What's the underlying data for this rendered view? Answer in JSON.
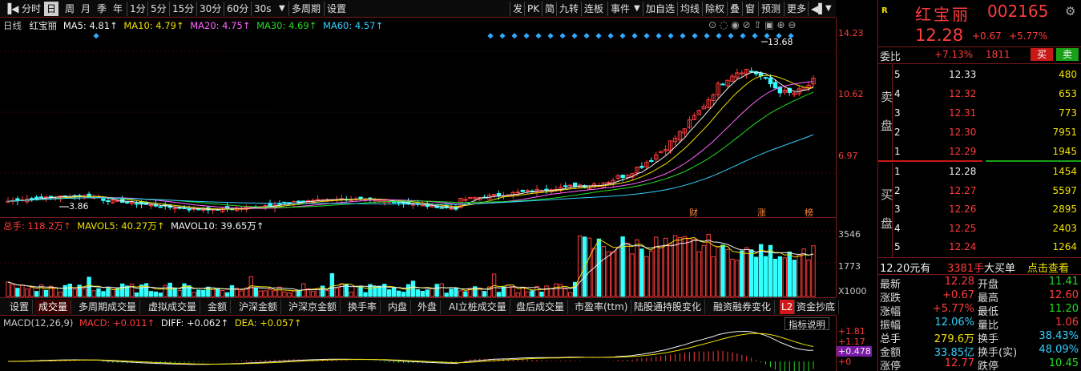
{
  "toolbar": {
    "left_items": [
      "分时",
      "日",
      "周",
      "月",
      "季",
      "年",
      "1分",
      "5分",
      "15分",
      "30分",
      "60分",
      "30s",
      "多周期",
      "设置"
    ],
    "active": "日",
    "right_items": [
      "发",
      "PK",
      "简",
      "九转",
      "连板",
      "事件",
      "加自选",
      "均线",
      "除权",
      "叠",
      "窗",
      "预测",
      "更多"
    ]
  },
  "main": {
    "legend_name": "日线",
    "stock_name": "红宝丽",
    "ma": [
      {
        "label": "MA5: 4.81↑",
        "color": "#f0f0f0"
      },
      {
        "label": "MA10: 4.79↑",
        "color": "#f0e000"
      },
      {
        "label": "MA20: 4.75↑",
        "color": "#ff66ff"
      },
      {
        "label": "MA30: 4.69↑",
        "color": "#22dd22"
      },
      {
        "label": "MA60: 4.57↑",
        "color": "#33d0ff"
      }
    ],
    "y_ticks": [
      "14.23",
      "10.62",
      "6.97"
    ],
    "high_label": "13.68",
    "low_label": "3.86",
    "markers": [
      "财",
      "涨",
      "榜"
    ]
  },
  "volume": {
    "legend": "总手: 118.2万↑",
    "mavol5": "MAVOL5: 40.27万↑",
    "mavol10": "MAVOL10: 39.65万↑",
    "y_ticks": [
      "3546",
      "1773"
    ],
    "unit": "X1000"
  },
  "tabs": [
    "设置",
    "成交量",
    "多周期成交量",
    "虚拟成交量",
    "金额",
    "沪深金额",
    "沪深京金额",
    "换手率",
    "内盘",
    "外盘",
    "AI立桩成交量",
    "盘后成交量",
    "市盈率(ttm)",
    "陆股通持股变化",
    "融资融券变化",
    "L2",
    "资金抄底"
  ],
  "active_tab": "成交量",
  "macd": {
    "title": "MACD(12,26,9)",
    "macd": "MACD: +0.011↑",
    "diff": "DIFF: +0.062↑",
    "dea": "DEA: +0.057↑",
    "button": "指标说明",
    "y_ticks": [
      "+1.81",
      "+1.17",
      "+0.478",
      "+0"
    ]
  },
  "panel": {
    "tag": "R",
    "name": "红宝丽",
    "code": "002165",
    "price": "12.28",
    "change": "+0.67",
    "change_pct": "+5.77%",
    "weibi_label": "委比",
    "weibi": "+7.13%",
    "weicha": "1811",
    "buy_btn": "买",
    "sell_btn": "卖",
    "sell_label": [
      "卖",
      "盘"
    ],
    "buy_label": [
      "买",
      "盘"
    ],
    "asks": [
      {
        "lvl": "5",
        "price": "12.33",
        "vol": "480"
      },
      {
        "lvl": "4",
        "price": "12.32",
        "vol": "653"
      },
      {
        "lvl": "3",
        "price": "12.31",
        "vol": "773"
      },
      {
        "lvl": "2",
        "price": "12.30",
        "vol": "7951"
      },
      {
        "lvl": "1",
        "price": "12.29",
        "vol": "1945"
      }
    ],
    "bids": [
      {
        "lvl": "1",
        "price": "12.28",
        "vol": "1454"
      },
      {
        "lvl": "2",
        "price": "12.27",
        "vol": "5597"
      },
      {
        "lvl": "3",
        "price": "12.26",
        "vol": "2895"
      },
      {
        "lvl": "4",
        "price": "12.25",
        "vol": "2403"
      },
      {
        "lvl": "5",
        "price": "12.24",
        "vol": "1264"
      }
    ],
    "bigorder": {
      "price": "12.20元有",
      "qty": "3381手",
      "label": "大买单",
      "action": "点击查看"
    },
    "stats": [
      {
        "l1": "最新",
        "v1": "12.28",
        "c1": "red",
        "l2": "开盘",
        "v2": "11.41",
        "c2": "green"
      },
      {
        "l1": "涨跌",
        "v1": "+0.67",
        "c1": "red",
        "l2": "最高",
        "v2": "12.60",
        "c2": "red"
      },
      {
        "l1": "涨幅",
        "v1": "+5.77%",
        "c1": "red",
        "l2": "最低",
        "v2": "11.20",
        "c2": "green"
      },
      {
        "l1": "振幅",
        "v1": "12.06%",
        "c1": "cyan",
        "l2": "量比",
        "v2": "1.06",
        "c2": "red"
      },
      {
        "l1": "总手",
        "v1": "279.6万",
        "c1": "yellow",
        "l2": "换手",
        "v2": "38.43%",
        "c2": "cyan"
      },
      {
        "l1": "金额",
        "v1": "33.85亿",
        "c1": "cyan",
        "l2": "换手(实)",
        "v2": "48.09%",
        "c2": "cyan"
      },
      {
        "l1": "涨停",
        "v1": "12.77",
        "c1": "red",
        "l2": "跌停",
        "v2": "10.45",
        "c2": "green"
      }
    ]
  },
  "colors": {
    "up": "#ff3c3c",
    "down": "#33ffff",
    "border": "#7a1a1a",
    "ma5": "#f0f0f0",
    "ma10": "#f0e000",
    "ma20": "#ff66ff",
    "ma30": "#22dd22",
    "ma60": "#33d0ff"
  }
}
